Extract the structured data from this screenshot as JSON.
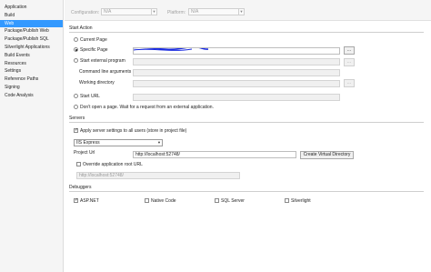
{
  "sidebar": {
    "items": [
      {
        "label": "Application"
      },
      {
        "label": "Build"
      },
      {
        "label": "Web",
        "active": true
      },
      {
        "label": "Package/Publish Web"
      },
      {
        "label": "Package/Publish SQL"
      },
      {
        "label": "Silverlight Applications"
      },
      {
        "label": "Build Events"
      },
      {
        "label": "Resources"
      },
      {
        "label": "Settings"
      },
      {
        "label": "Reference Paths"
      },
      {
        "label": "Signing"
      },
      {
        "label": "Code Analysis"
      }
    ]
  },
  "topbar": {
    "configuration_label": "Configuration:",
    "configuration_value": "N/A",
    "platform_label": "Platform:",
    "platform_value": "N/A"
  },
  "start_action": {
    "header": "Start Action",
    "current_page": "Current Page",
    "specific_page": "Specific Page",
    "specific_page_value": "",
    "start_external_program": "Start external program",
    "command_line_arguments": "Command line arguments",
    "working_directory": "Working directory",
    "start_url": "Start URL",
    "dont_open": "Don't open a page.  Wait for a request from an external application.",
    "browse_label": "...",
    "selected": "specific_page"
  },
  "servers": {
    "header": "Servers",
    "apply_all_users": "Apply server settings to all users (store in project file)",
    "apply_all_users_checked": true,
    "server_type": "IIS Express",
    "project_url_label": "Project Url",
    "project_url_value": "http://localhost:52748/",
    "create_vdir_label": "Create Virtual Directory",
    "override_root_label": "Override application root URL",
    "override_root_checked": false,
    "override_root_value": "http://localhost:52748/"
  },
  "debuggers": {
    "header": "Debuggers",
    "items": [
      {
        "label": "ASP.NET",
        "checked": true
      },
      {
        "label": "Native Code",
        "checked": false
      },
      {
        "label": "SQL Server",
        "checked": false
      },
      {
        "label": "Silverlight",
        "checked": false
      }
    ]
  },
  "colors": {
    "accent": "#3399ff",
    "scribble": "#1a2be0"
  }
}
